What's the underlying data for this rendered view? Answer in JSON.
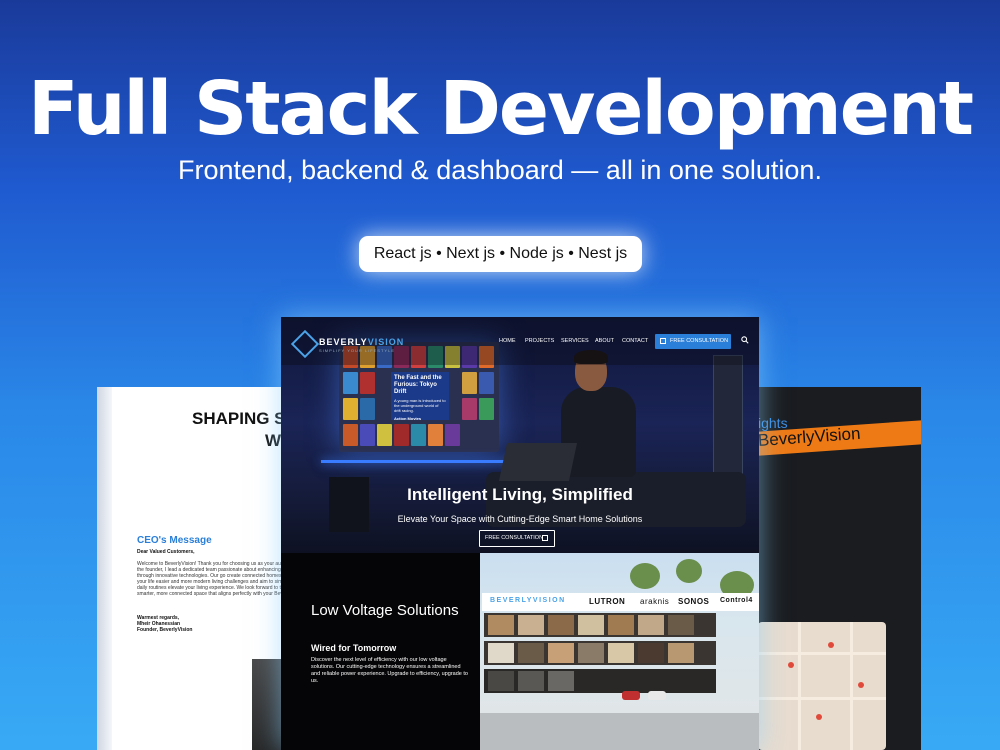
{
  "hero": {
    "title": "Full Stack Development",
    "subtitle": "Frontend, backend & dashboard — all in one solution.",
    "tech_stack": "React js • Next js • Node js • Nest js"
  },
  "left_page": {
    "heading_line1": "SHAPING S",
    "heading_line2": "W",
    "ceo_title": "CEO's Message",
    "greeting": "Dear Valued Customers,",
    "body": "Welcome to BeverlyVision! Thank you for choosing us as your automation. As the founder, I lead a dedicated team passionate about enhancing your home through innovative technologies. Our go create connected homes that make your life easier and more modern living challenges and aim to simplify your daily routines elevate your living experience. We look forward to transforming smarter, more connected space that aligns perfectly with your BeverlyVision!",
    "regards": "Warmest regards,",
    "name": "Mheir Ohanessian",
    "role": "Founder, BeverlyVision"
  },
  "right_page": {
    "partial_text": "ights",
    "banner_text": "BeverlyVision"
  },
  "site": {
    "logo_primary": "BEVERLY",
    "logo_accent": "VISION",
    "logo_tagline": "SIMPLIFY YOUR LIFESTYLE",
    "nav_items": [
      "HOME",
      "PROJECTS",
      "SERVICES",
      "ABOUT",
      "CONTACT"
    ],
    "nav_cta": "FREE CONSULTATION",
    "screen_title": "The Fast and the Furious: Tokyo Drift",
    "screen_text": "A young man is introduced to the underground world of drift racing.",
    "screen_footer": "Action Movies",
    "hero_heading": "Intelligent Living, Simplified",
    "hero_text": "Elevate Your Space with Cutting-Edge Smart Home Solutions",
    "hero_button": "FREE CONSULTATION",
    "lv_heading": "Low Voltage Solutions",
    "lv_subheading": "Wired for Tomorrow",
    "lv_body": "Discover the next level of efficiency with our low voltage solutions. Our cutting-edge technology ensures a streamlined and reliable power experience. Upgrade to efficiency, upgrade to us.",
    "brands": [
      "BEVERLYVISION",
      "LUTRON",
      "araknis",
      "SONOS",
      "Control4"
    ]
  },
  "colors": {
    "accent_blue": "#2a7fd8",
    "orange": "#ee7a15",
    "background_top": "#1a3a9a",
    "background_bottom": "#38aaf5"
  },
  "icons": [
    "calendar-icon",
    "search-icon",
    "logo-diamond-icon"
  ]
}
